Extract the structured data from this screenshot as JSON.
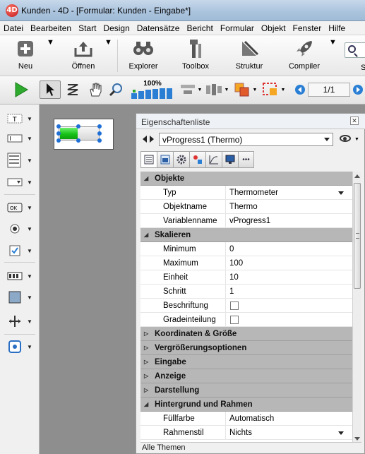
{
  "window": {
    "title": "Kunden - 4D - [Formular: Kunden -  Eingabe*]",
    "app_icon": "4D"
  },
  "menubar": [
    "Datei",
    "Bearbeiten",
    "Start",
    "Design",
    "Datensätze",
    "Bericht",
    "Formular",
    "Objekt",
    "Fenster",
    "Hilfe"
  ],
  "toolbar": {
    "buttons": [
      {
        "label": "Neu",
        "icon": "plus-icon"
      },
      {
        "label": "Öffnen",
        "icon": "open-icon"
      },
      {
        "label": "Explorer",
        "icon": "binoculars-icon"
      },
      {
        "label": "Toolbox",
        "icon": "toolbox-icon"
      },
      {
        "label": "Struktur",
        "icon": "structure-icon"
      },
      {
        "label": "Compiler",
        "icon": "rocket-icon"
      }
    ],
    "search_label": "S"
  },
  "form_toolbar": {
    "zoom_label": "100%",
    "page_indicator": "1/1"
  },
  "properties": {
    "title": "Eigenschaftenliste",
    "object_selector": "vProgress1 (Thermo)",
    "footer": "Alle Themen",
    "sections": [
      {
        "title": "Objekte",
        "expanded": true,
        "props": [
          {
            "name": "Typ",
            "value": "Thermometer",
            "dropdown": true
          },
          {
            "name": "Objektname",
            "value": "Thermo"
          },
          {
            "name": "Variablenname",
            "value": "vProgress1"
          }
        ]
      },
      {
        "title": "Skalieren",
        "expanded": true,
        "props": [
          {
            "name": "Minimum",
            "value": "0"
          },
          {
            "name": "Maximum",
            "value": "100"
          },
          {
            "name": "Einheit",
            "value": "10"
          },
          {
            "name": "Schritt",
            "value": "1"
          },
          {
            "name": "Beschriftung",
            "checkbox": true
          },
          {
            "name": "Gradeinteilung",
            "checkbox": true
          }
        ]
      },
      {
        "title": "Koordinaten & Größe",
        "expanded": false,
        "props": []
      },
      {
        "title": "Vergrößerungsoptionen",
        "expanded": false,
        "props": []
      },
      {
        "title": "Eingabe",
        "expanded": false,
        "props": []
      },
      {
        "title": "Anzeige",
        "expanded": false,
        "props": []
      },
      {
        "title": "Darstellung",
        "expanded": false,
        "props": []
      },
      {
        "title": "Hintergrund und Rahmen",
        "expanded": true,
        "props": [
          {
            "name": "Füllfarbe",
            "value": "Automatisch"
          },
          {
            "name": "Rahmenstil",
            "value": "Nichts",
            "dropdown": true
          }
        ]
      }
    ]
  },
  "thermometer": {
    "fill_fraction": 0.45
  }
}
